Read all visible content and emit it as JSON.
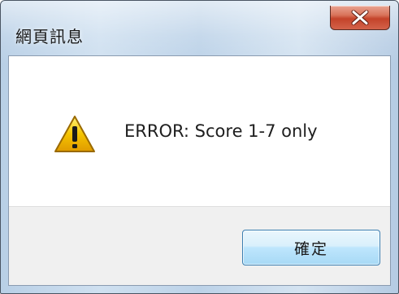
{
  "window": {
    "title": "網頁訊息"
  },
  "dialog": {
    "message": "ERROR: Score 1-7 only",
    "icon": "warning-icon",
    "ok_label": "確定"
  },
  "colors": {
    "close_button": "#c4432a",
    "ok_button_border": "#3c7fb1",
    "warning_fill": "#f5c400"
  }
}
